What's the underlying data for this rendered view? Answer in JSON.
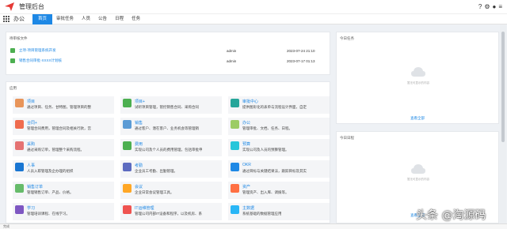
{
  "header": {
    "title": "管理后台",
    "icons": [
      "help-icon",
      "gear-icon",
      "user-icon",
      "more-icon"
    ]
  },
  "nav": {
    "section": "办公",
    "tabs": [
      "首页",
      "审批任务",
      "人员",
      "公告",
      "日程",
      "任务"
    ],
    "active_tab": "首页"
  },
  "todo": {
    "title": "待审核文件",
    "items": [
      {
        "title": "立项-项目管理系统开发",
        "user": "admin",
        "time": "2023-07-24 21:10"
      },
      {
        "title": "销售合同审批-XXXX计划核",
        "user": "admin",
        "time": "2023-07-17 01:13"
      }
    ]
  },
  "apps": {
    "title": "应用",
    "items": [
      {
        "name": "项目",
        "desc": "通过项目、任务、甘特图，管理项目的整",
        "color": "#e8955a"
      },
      {
        "name": "项目+",
        "desc": "试听项目管理，管控销售合同、采购合同",
        "color": "#4caf50"
      },
      {
        "name": "审批中心",
        "desc": "提供图形化的表单与流程设计界面，自定",
        "color": "#26a69a"
      },
      {
        "name": "合同+",
        "desc": "管理合同费用，管理合同及相关行款，宫",
        "color": "#ef6c4f"
      },
      {
        "name": "销售",
        "desc": "通过客户、潜在客户、业务机会等管理销",
        "color": "#5b9bd5"
      },
      {
        "name": "办公",
        "desc": "管理审批、文档、任务、日程。",
        "color": "#9ccc65"
      },
      {
        "name": "采购",
        "desc": "通过采购订单，管理整个采购流程。",
        "color": "#e57373"
      },
      {
        "name": "费用",
        "desc": "实现公司及个人员的费用管理，包括审批申",
        "color": "#4caf50"
      },
      {
        "name": "预算",
        "desc": "实现公司及人员的预算管理。",
        "color": "#26c6da"
      },
      {
        "name": "人事",
        "desc": "人员入职管理及企办理的组织",
        "color": "#1976d2"
      },
      {
        "name": "考勤",
        "desc": "企业员工考勤、出勤管理。",
        "color": "#5c6bc0"
      },
      {
        "name": "OKR",
        "desc": "通过目标与关键结果法，跟踪目标及其实",
        "color": "#1e88e5"
      },
      {
        "name": "销售订单",
        "desc": "管理销售订单、产品、价格。",
        "color": "#66bb6a"
      },
      {
        "name": "会议",
        "desc": "企业日常会议管理工具。",
        "color": "#ffa726"
      },
      {
        "name": "资产",
        "desc": "管理资产、出入库、调拨等。",
        "color": "#ff7043"
      },
      {
        "name": "学习",
        "desc": "管理培训课程、在线学习。",
        "color": "#7e57c2"
      },
      {
        "name": "IT运维管理",
        "desc": "管理公司内部IT设备和程序，以及机房、系",
        "color": "#ef5350"
      },
      {
        "name": "主数据",
        "desc": "系统基础的数据管理应用",
        "color": "#29b6f6"
      }
    ]
  },
  "tasks_panel": {
    "title": "今日任务",
    "empty_text": "暂无可显示的内容",
    "view_all": "查看全部"
  },
  "schedule_panel": {
    "title": "今日日程",
    "empty_text": "暂无可显示的内容",
    "view_all": "查看全部"
  },
  "status": {
    "text": "完成"
  },
  "watermark": {
    "text": "头条 @淘源码"
  }
}
